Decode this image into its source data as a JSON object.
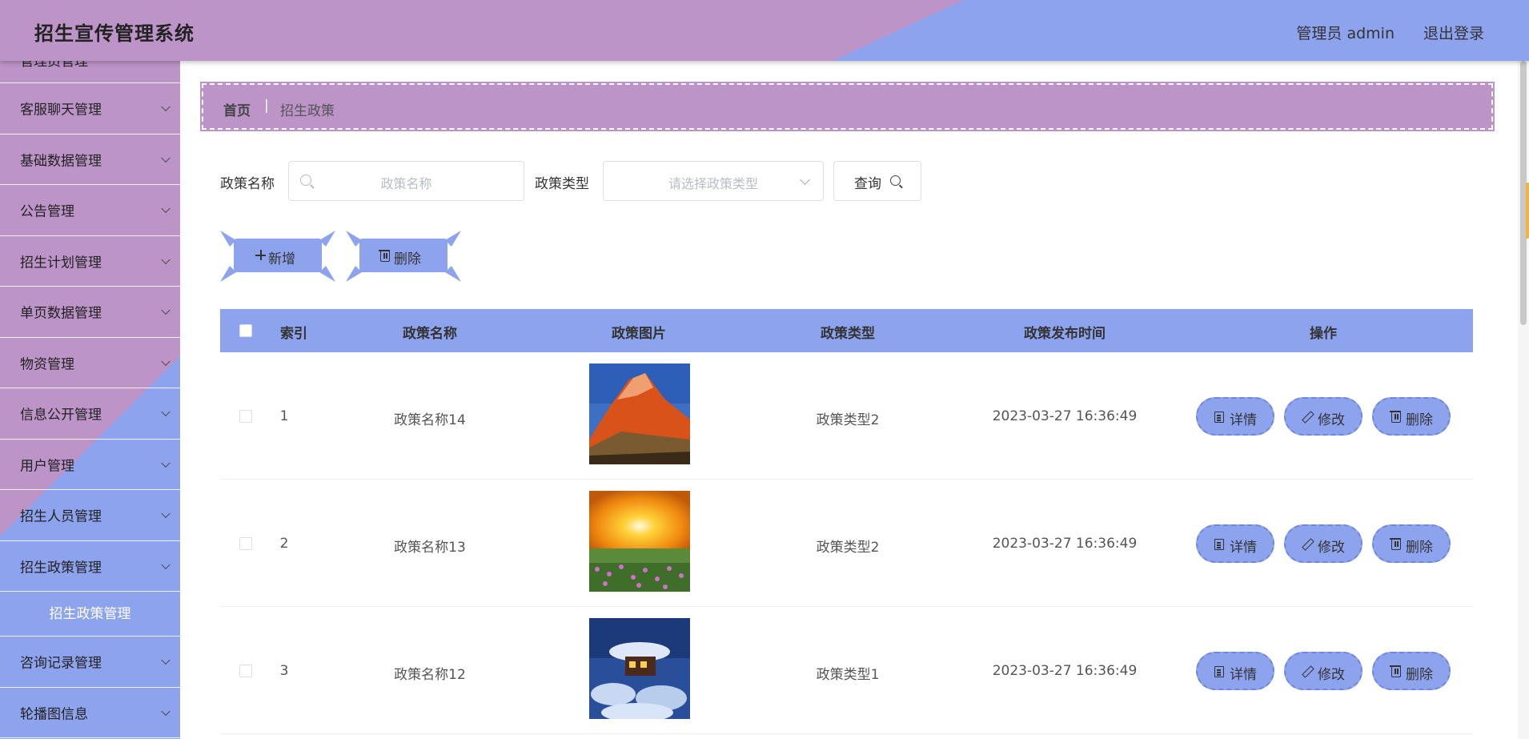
{
  "app": {
    "title": "招生宣传管理系统"
  },
  "header": {
    "user": "管理员 admin",
    "logout": "退出登录"
  },
  "sidebar": {
    "items": [
      {
        "label": "管理员管理"
      },
      {
        "label": "客服聊天管理"
      },
      {
        "label": "基础数据管理"
      },
      {
        "label": "公告管理"
      },
      {
        "label": "招生计划管理"
      },
      {
        "label": "单页数据管理"
      },
      {
        "label": "物资管理"
      },
      {
        "label": "信息公开管理"
      },
      {
        "label": "用户管理"
      },
      {
        "label": "招生人员管理"
      },
      {
        "label": "招生政策管理"
      },
      {
        "label": "咨询记录管理"
      },
      {
        "label": "轮播图信息"
      }
    ],
    "active_sub": "招生政策管理"
  },
  "breadcrumb": {
    "home": "首页",
    "separator": "|",
    "current": "招生政策"
  },
  "filters": {
    "name_label": "政策名称",
    "name_placeholder": "政策名称",
    "type_label": "政策类型",
    "type_placeholder": "请选择政策类型",
    "query_button": "查询"
  },
  "actions": {
    "add": "新增",
    "delete": "删除"
  },
  "table": {
    "columns": [
      "索引",
      "政策名称",
      "政策图片",
      "政策类型",
      "政策发布时间",
      "操作"
    ],
    "rows": [
      {
        "index": "1",
        "name": "政策名称14",
        "image": "mountain-photo",
        "type": "政策类型2",
        "time": "2023-03-27 16:36:49"
      },
      {
        "index": "2",
        "name": "政策名称13",
        "image": "sunset-field-photo",
        "type": "政策类型2",
        "time": "2023-03-27 16:36:49"
      },
      {
        "index": "3",
        "name": "政策名称12",
        "image": "snow-house-photo",
        "type": "政策类型1",
        "time": "2023-03-27 16:36:49"
      }
    ],
    "row_actions": {
      "detail": "详情",
      "edit": "修改",
      "delete": "删除"
    }
  },
  "colors": {
    "purple": "#bc94c8",
    "blue": "#8ea3ee"
  }
}
